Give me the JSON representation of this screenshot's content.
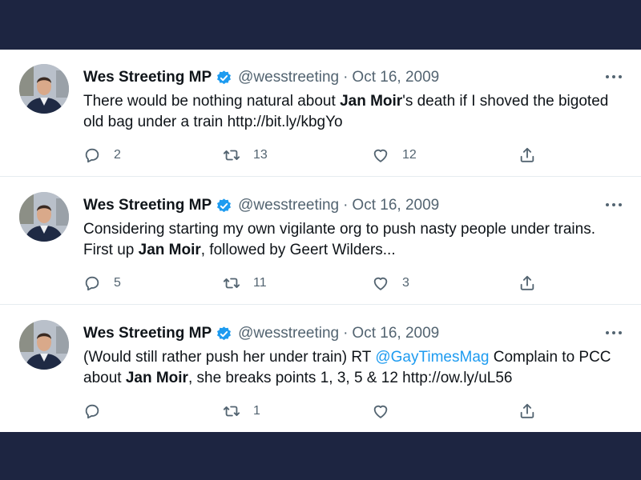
{
  "tweets": [
    {
      "author_name": "Wes Streeting MP",
      "handle": "@wesstreeting",
      "separator": "·",
      "date": "Oct 16, 2009",
      "body_1": "There would be nothing natural about ",
      "body_bold_1": "Jan Moir",
      "body_2": "'s death if I shoved the bigoted old bag under a train http://bit.ly/kbgYo",
      "replies": "2",
      "retweets": "13",
      "likes": "12"
    },
    {
      "author_name": "Wes Streeting MP",
      "handle": "@wesstreeting",
      "separator": "·",
      "date": "Oct 16, 2009",
      "body_1": "Considering starting my own vigilante org to push nasty people under trains. First up ",
      "body_bold_1": "Jan Moir",
      "body_2": ", followed by Geert Wilders...",
      "replies": "5",
      "retweets": "11",
      "likes": "3"
    },
    {
      "author_name": "Wes Streeting MP",
      "handle": "@wesstreeting",
      "separator": "·",
      "date": "Oct 16, 2009",
      "body_1": "(Would still rather push her under train) RT ",
      "mention": "@GayTimesMag",
      "body_2": " Complain to PCC about ",
      "body_bold_1": "Jan Moir",
      "body_3": ", she breaks points 1, 3, 5 & 12 http://ow.ly/uL56",
      "replies": "",
      "retweets": "1",
      "likes": ""
    }
  ],
  "icons": {
    "verified": "verified-badge-icon",
    "more": "more-horizontal-icon",
    "reply": "reply-icon",
    "retweet": "retweet-icon",
    "like": "heart-icon",
    "share": "share-icon"
  },
  "colors": {
    "frame": "#1d2541",
    "text": "#0f1419",
    "secondary": "#536471",
    "accent": "#1d9bf0",
    "divider": "#e6ecf0"
  }
}
